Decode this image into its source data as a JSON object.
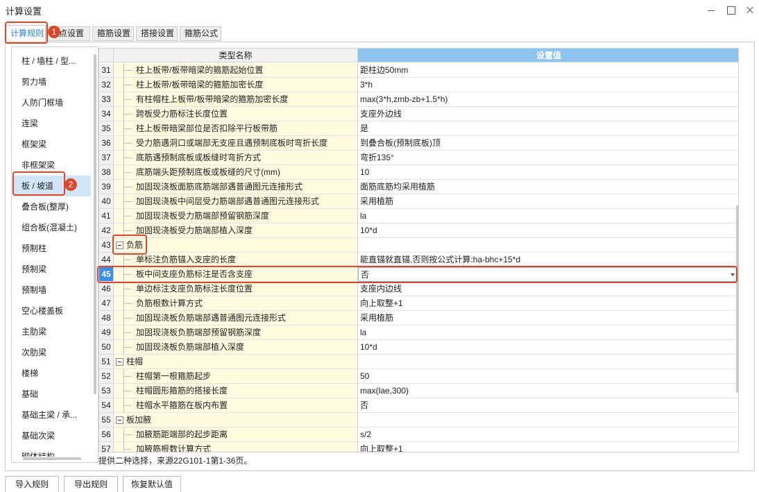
{
  "window": {
    "title": "计算设置",
    "controls": [
      "minimize-icon",
      "maximize-icon",
      "close-icon"
    ]
  },
  "tabs": [
    {
      "label": "计算规则",
      "active": true
    },
    {
      "label": "节点设置"
    },
    {
      "label": "箍筋设置"
    },
    {
      "label": "搭接设置"
    },
    {
      "label": "箍筋公式"
    }
  ],
  "sidebar": {
    "items": [
      {
        "label": "柱 / 墙柱 / 型..."
      },
      {
        "label": "剪力墙"
      },
      {
        "label": "人防门框墙"
      },
      {
        "label": "连梁"
      },
      {
        "label": "框架梁"
      },
      {
        "label": "非框架梁"
      },
      {
        "label": "板 / 坡道",
        "active": true
      },
      {
        "label": "叠合板(整厚)"
      },
      {
        "label": "组合板(混凝土)"
      },
      {
        "label": "预制柱"
      },
      {
        "label": "预制梁"
      },
      {
        "label": "预制墙"
      },
      {
        "label": "空心楼盖板"
      },
      {
        "label": "主肋梁"
      },
      {
        "label": "次肋梁"
      },
      {
        "label": "楼梯"
      },
      {
        "label": "基础"
      },
      {
        "label": "基础主梁 / 承..."
      },
      {
        "label": "基础次梁"
      },
      {
        "label": "砌体结构"
      }
    ]
  },
  "grid": {
    "columns": {
      "name": "类型名称",
      "value": "设置值"
    },
    "rows": [
      {
        "num": "31",
        "name": "柱上板带/板带暗梁的箍筋起始位置",
        "value": "距柱边50mm"
      },
      {
        "num": "32",
        "name": "柱上板带/板带暗梁的箍筋加密长度",
        "value": "3*h"
      },
      {
        "num": "33",
        "name": "有柱帽柱上板带/板带暗梁的箍筋加密长度",
        "value": "max(3*h,zmb-zb+1.5*h)"
      },
      {
        "num": "34",
        "name": "跨板受力筋标注长度位置",
        "value": "支座外边线"
      },
      {
        "num": "35",
        "name": "柱上板带暗梁部位是否扣除平行板带筋",
        "value": "是"
      },
      {
        "num": "36",
        "name": "受力筋遇洞口或端部无支座且遇预制底板时弯折长度",
        "value": "到叠合板(预制底板)顶"
      },
      {
        "num": "37",
        "name": "底筋遇预制底板或板缝时弯折方式",
        "value": "弯折135°"
      },
      {
        "num": "38",
        "name": "底筋端头距预制底板或板缝的尺寸(mm)",
        "value": "10"
      },
      {
        "num": "39",
        "name": "加固现浇板面筋底筋端部遇普通图元连接形式",
        "value": "面筋底筋均采用植筋"
      },
      {
        "num": "40",
        "name": "加固现浇板中间层受力筋端部遇普通图元连接形式",
        "value": "采用植筋"
      },
      {
        "num": "41",
        "name": "加固现浇板受力筋端部预留钢筋深度",
        "value": "la"
      },
      {
        "num": "42",
        "name": "加固现浇板受力筋端部植入深度",
        "value": "10*d"
      },
      {
        "num": "43",
        "name": "负筋",
        "value": "",
        "group": true
      },
      {
        "num": "44",
        "name": "单标注负筋锚入支座的长度",
        "value": "能直锚就直锚,否则按公式计算:ha-bhc+15*d"
      },
      {
        "num": "45",
        "name": "板中间支座负筋标注是否含支座",
        "value": "否",
        "selected": true
      },
      {
        "num": "46",
        "name": "单边标注支座负筋标注长度位置",
        "value": "支座内边线"
      },
      {
        "num": "47",
        "name": "负筋根数计算方式",
        "value": "向上取整+1"
      },
      {
        "num": "48",
        "name": "加固现浇板负筋端部遇普通图元连接形式",
        "value": "采用植筋"
      },
      {
        "num": "49",
        "name": "加固现浇板负筋端部预留钢筋深度",
        "value": "la"
      },
      {
        "num": "50",
        "name": "加固现浇板负筋端部植入深度",
        "value": "10*d"
      },
      {
        "num": "51",
        "name": "柱帽",
        "value": "",
        "group": true
      },
      {
        "num": "52",
        "name": "柱帽第一根箍筋起步",
        "value": "50"
      },
      {
        "num": "53",
        "name": "柱帽圆形箍筋的搭接长度",
        "value": "max(lae,300)"
      },
      {
        "num": "54",
        "name": "柱帽水平箍筋在板内布置",
        "value": "否"
      },
      {
        "num": "55",
        "name": "板加腋",
        "value": "",
        "group": true
      },
      {
        "num": "56",
        "name": "加腋筋距端部的起步距离",
        "value": "s/2"
      },
      {
        "num": "57",
        "name": "加腋筋根数计算方式",
        "value": "向上取整+1"
      }
    ]
  },
  "hint": "提供二种选择，来源22G101-1第1-36页。",
  "buttons": {
    "import": "导入规则",
    "export": "导出规则",
    "restore": "恢复默认值"
  },
  "annotations": [
    "1",
    "2"
  ],
  "colors": {
    "accent": "#2a7fd0",
    "header_value_bg": "#8ec4ef",
    "name_cell_bg": "#fffbe0",
    "selected_row_num": "#3a8ee6",
    "sidebar_active_bg": "#d2e5f6",
    "annotation": "#d9482b"
  }
}
